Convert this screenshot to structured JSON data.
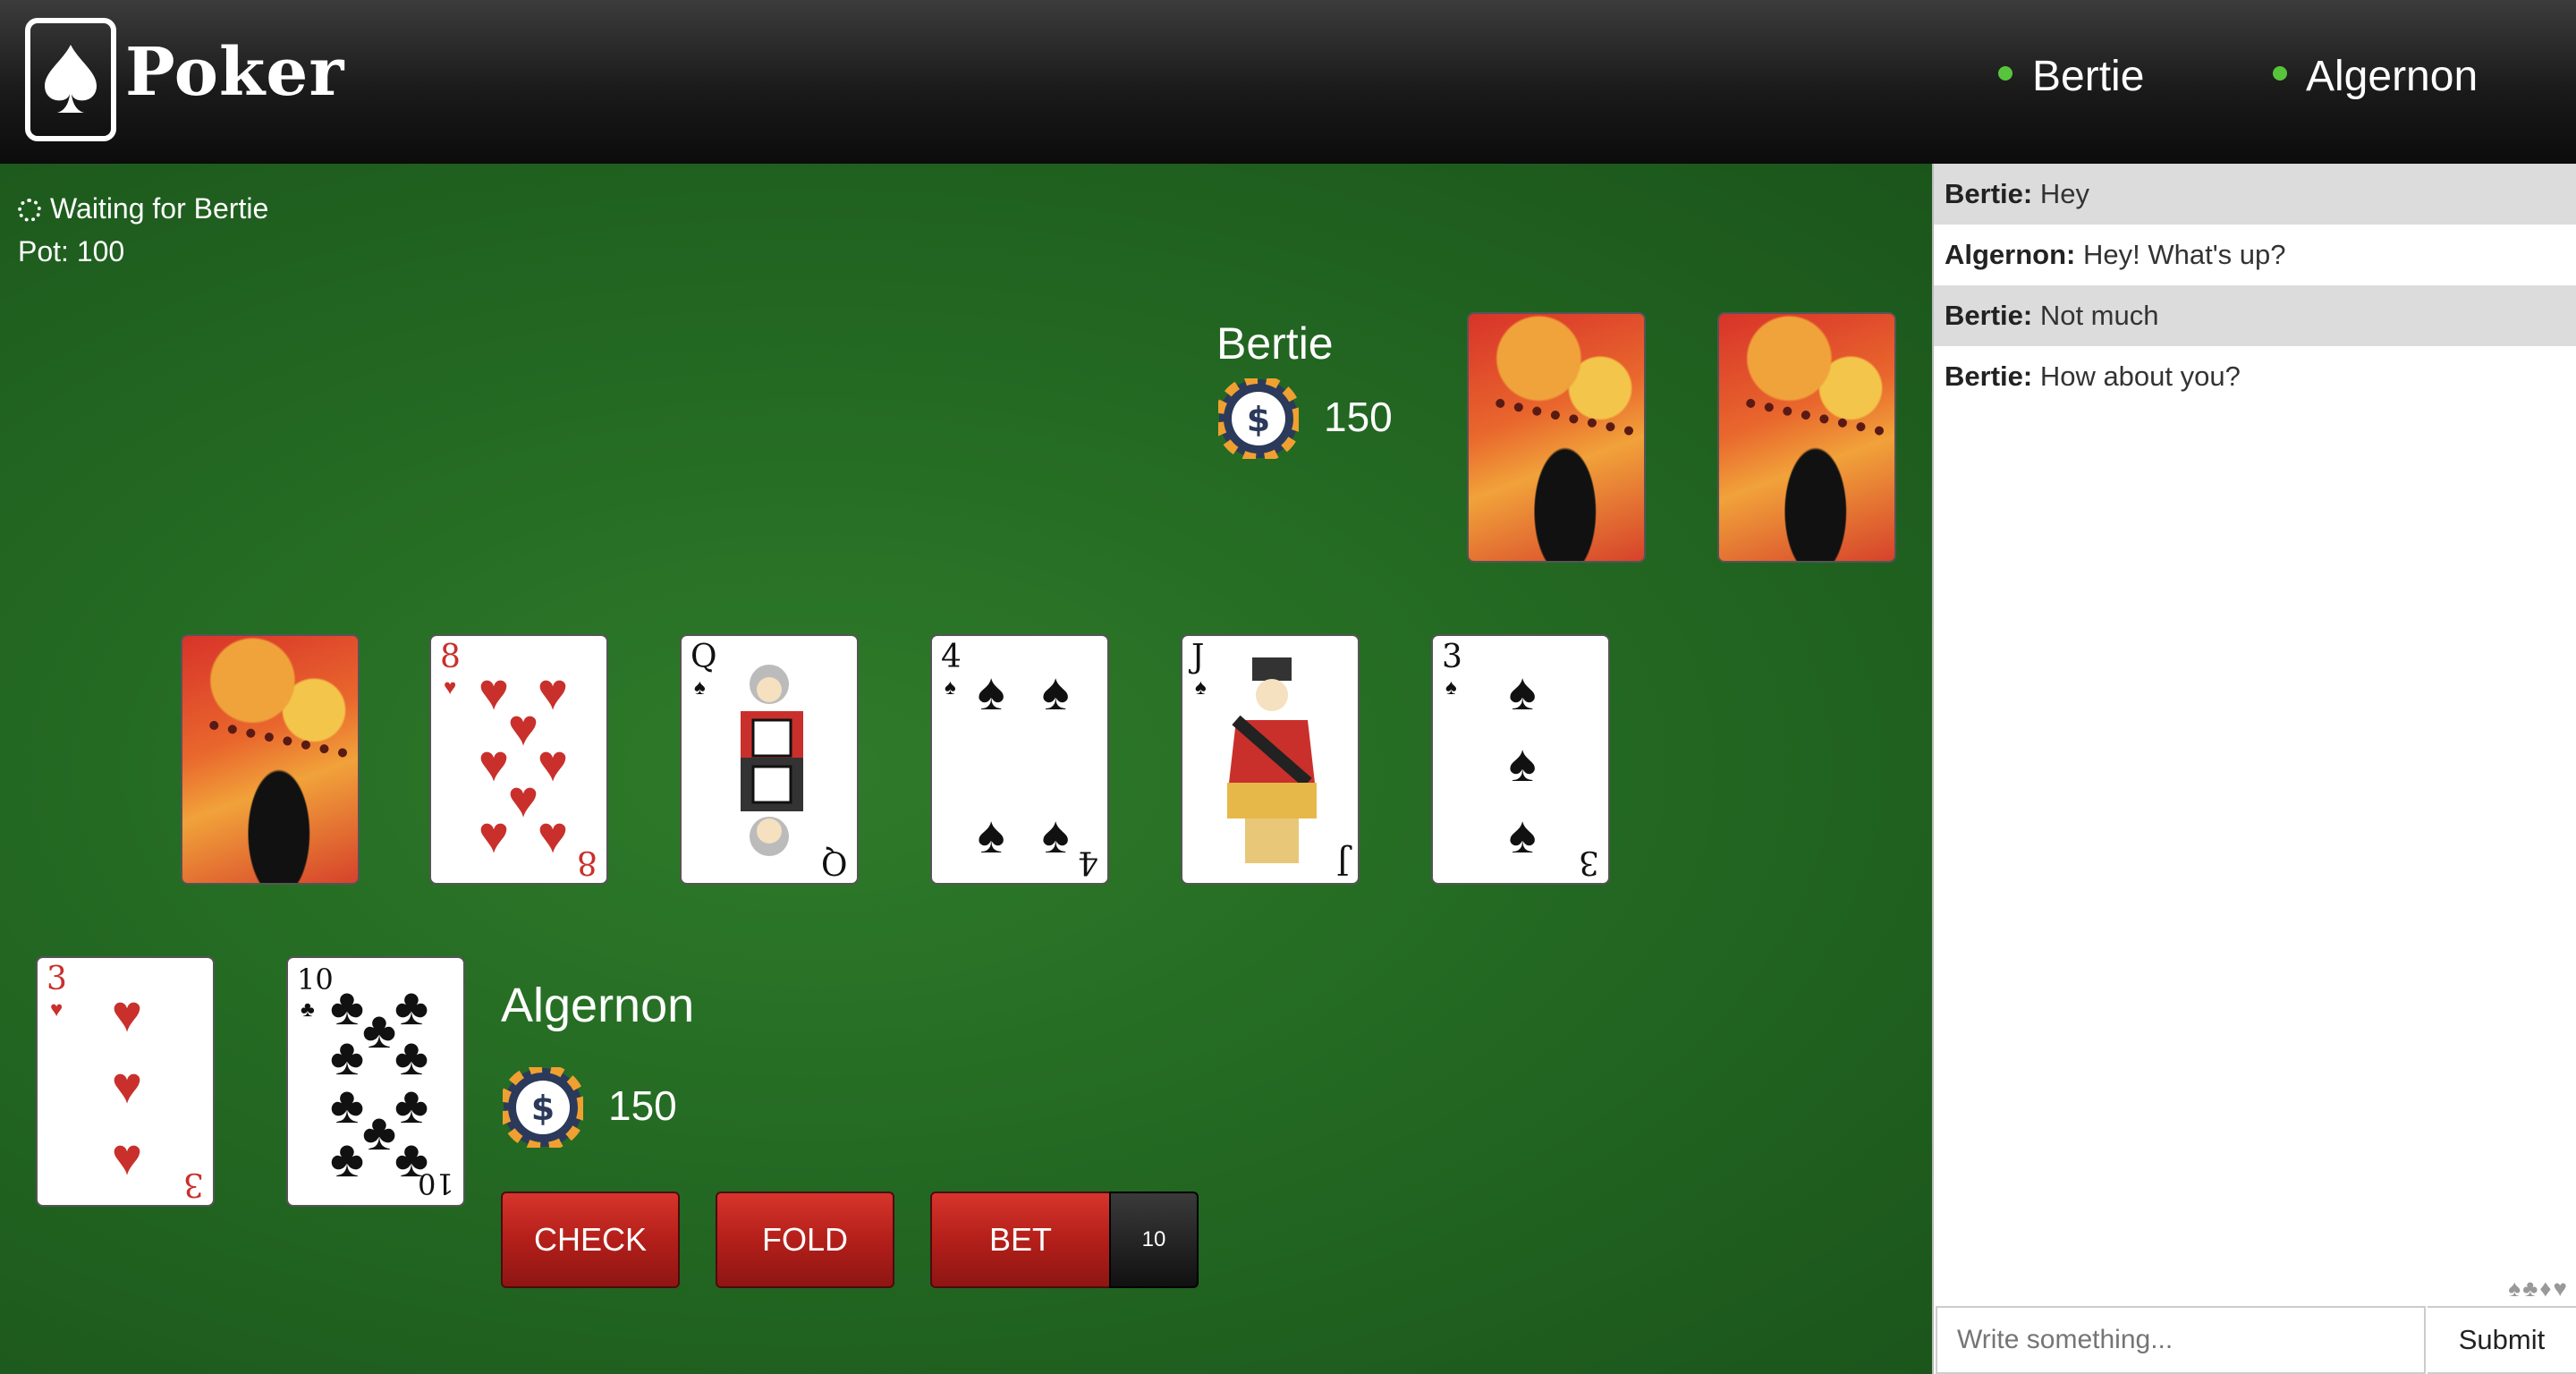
{
  "app": {
    "title": "Poker"
  },
  "header": {
    "players": [
      {
        "name": "Bertie",
        "status": "online"
      },
      {
        "name": "Algernon",
        "status": "online"
      }
    ]
  },
  "table": {
    "status_text": "Waiting for Bertie",
    "pot_text": "Pot: 100",
    "opponent": {
      "name": "Bertie",
      "chips": "150",
      "cards": [
        "back",
        "back"
      ]
    },
    "community_cards": [
      {
        "face": "back"
      },
      {
        "rank": "8",
        "suit": "♥"
      },
      {
        "rank": "Q",
        "suit": "♠"
      },
      {
        "rank": "4",
        "suit": "♠"
      },
      {
        "rank": "J",
        "suit": "♠"
      },
      {
        "rank": "3",
        "suit": "♠"
      }
    ],
    "player": {
      "name": "Algernon",
      "chips": "150",
      "cards": [
        {
          "rank": "3",
          "suit": "♥"
        },
        {
          "rank": "10",
          "suit": "♣"
        }
      ]
    },
    "actions": {
      "check": "CHECK",
      "fold": "FOLD",
      "bet": "BET",
      "bet_amount": "10"
    }
  },
  "chat": {
    "messages": [
      {
        "sender": "Bertie:",
        "text": " Hey"
      },
      {
        "sender": "Algernon:",
        "text": " Hey! What's up?"
      },
      {
        "sender": "Bertie:",
        "text": " Not much"
      },
      {
        "sender": "Bertie:",
        "text": " How about you?"
      }
    ],
    "suits_decoration": "♠♣♦♥",
    "input_placeholder": "Write something...",
    "submit_label": "Submit"
  },
  "colors": {
    "felt": "#2f7b2a",
    "button_red": "#c9302c",
    "online_dot": "#58c43c"
  }
}
